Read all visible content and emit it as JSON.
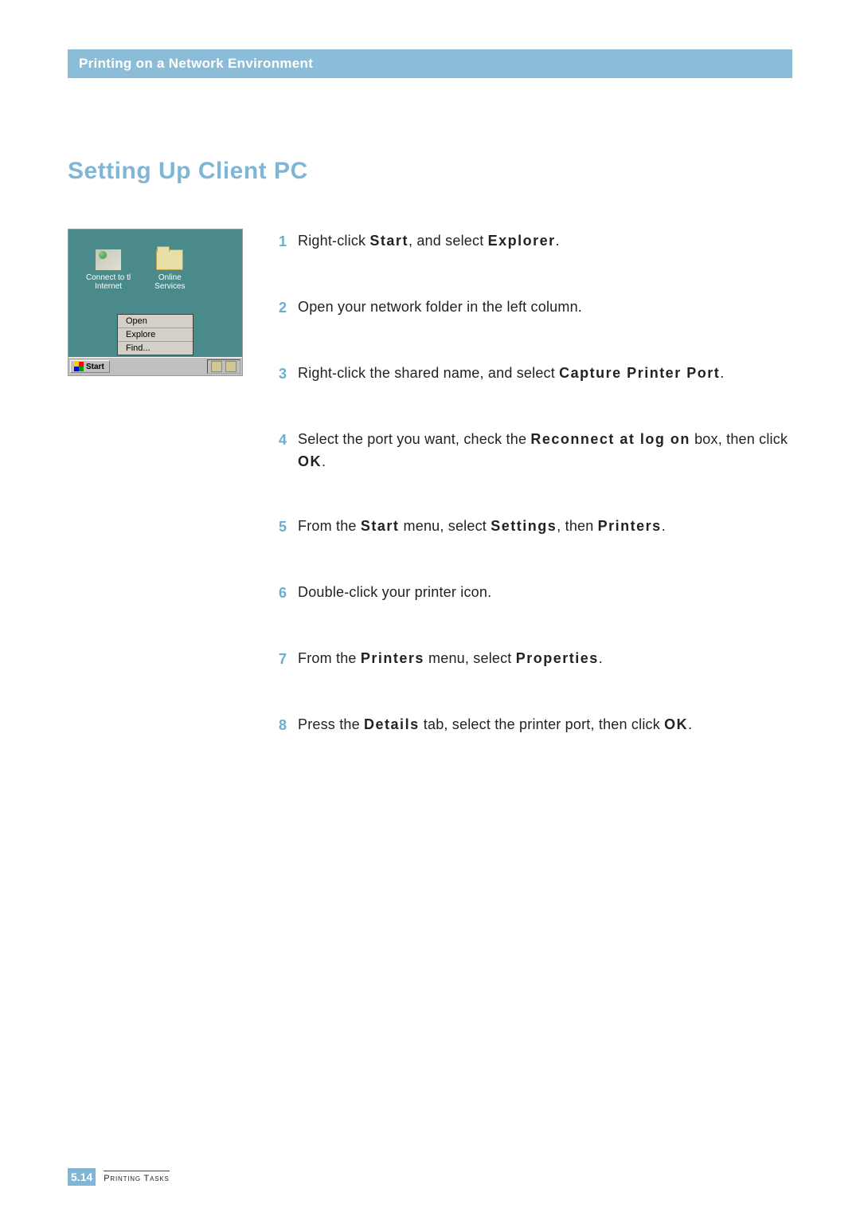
{
  "header": {
    "title": "Printing on a Network Environment"
  },
  "section": {
    "title": "Setting Up Client PC"
  },
  "screenshot": {
    "icons": [
      {
        "label": "Connect to tl\nInternet"
      },
      {
        "label": "Online\nServices"
      }
    ],
    "context_menu": [
      "Open",
      "Explore",
      "Find..."
    ],
    "start_label": "Start"
  },
  "steps": [
    {
      "num": "1",
      "html": "Right-click <b class='term'>Start</b>, and select <b class='term'>Explorer</b>."
    },
    {
      "num": "2",
      "html": "Open your network folder in the left column."
    },
    {
      "num": "3",
      "html": "Right-click the shared name, and select <b class='term'>Capture Printer Port</b>."
    },
    {
      "num": "4",
      "html": "Select the port you want, check the <b class='term'>Reconnect at log on</b> box, then click <b class='term'>OK</b>."
    },
    {
      "num": "5",
      "html": "From the <b class='term'>Start</b> menu, select <b class='term'>Settings</b>, then <b class='term'>Printers</b>."
    },
    {
      "num": "6",
      "html": "Double-click your printer icon."
    },
    {
      "num": "7",
      "html": "From the <b class='term'>Printers</b> menu, select <b class='term'>Properties</b>."
    },
    {
      "num": "8",
      "html": "Press the <b class='term'>Details</b> tab, select the printer port, then click <b class='term'>OK</b>."
    }
  ],
  "footer": {
    "chapter": "5.",
    "page": "14",
    "label": "Printing Tasks"
  }
}
